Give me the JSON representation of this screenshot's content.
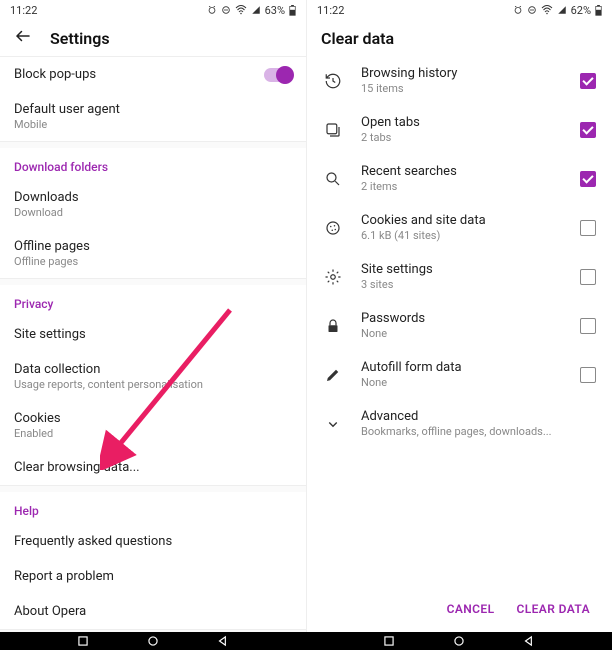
{
  "left": {
    "status": {
      "time": "11:22",
      "battery": "63%"
    },
    "title": "Settings",
    "groupA": {
      "popups": {
        "label": "Block pop-ups",
        "toggled": true
      },
      "agent": {
        "label": "Default user agent",
        "sub": "Mobile"
      }
    },
    "downloads": {
      "header": "Download folders",
      "d1": {
        "label": "Downloads",
        "sub": "Download"
      },
      "d2": {
        "label": "Offline pages",
        "sub": "Offline pages"
      }
    },
    "privacy": {
      "header": "Privacy",
      "site": {
        "label": "Site settings"
      },
      "data": {
        "label": "Data collection",
        "sub": "Usage reports, content personalisation"
      },
      "cookies": {
        "label": "Cookies",
        "sub": "Enabled"
      },
      "clear": {
        "label": "Clear browsing data..."
      }
    },
    "help": {
      "header": "Help",
      "faq": {
        "label": "Frequently asked questions"
      },
      "report": {
        "label": "Report a problem"
      },
      "about": {
        "label": "About Opera"
      }
    }
  },
  "right": {
    "status": {
      "time": "11:22",
      "battery": "62%"
    },
    "title": "Clear data",
    "items": {
      "history": {
        "title": "Browsing history",
        "sub": "15 items",
        "checked": true
      },
      "tabs": {
        "title": "Open tabs",
        "sub": "2 tabs",
        "checked": true
      },
      "searches": {
        "title": "Recent searches",
        "sub": "2 items",
        "checked": true
      },
      "cookies": {
        "title": "Cookies and site data",
        "sub": "6.1 kB (41 sites)",
        "checked": false
      },
      "site": {
        "title": "Site settings",
        "sub": "3 sites",
        "checked": false
      },
      "pw": {
        "title": "Passwords",
        "sub": "None",
        "checked": false
      },
      "autofill": {
        "title": "Autofill form data",
        "sub": "None",
        "checked": false
      },
      "adv": {
        "title": "Advanced",
        "sub": "Bookmarks, offline pages, downloads..."
      }
    },
    "actions": {
      "cancel": "CANCEL",
      "clear": "CLEAR DATA"
    }
  }
}
